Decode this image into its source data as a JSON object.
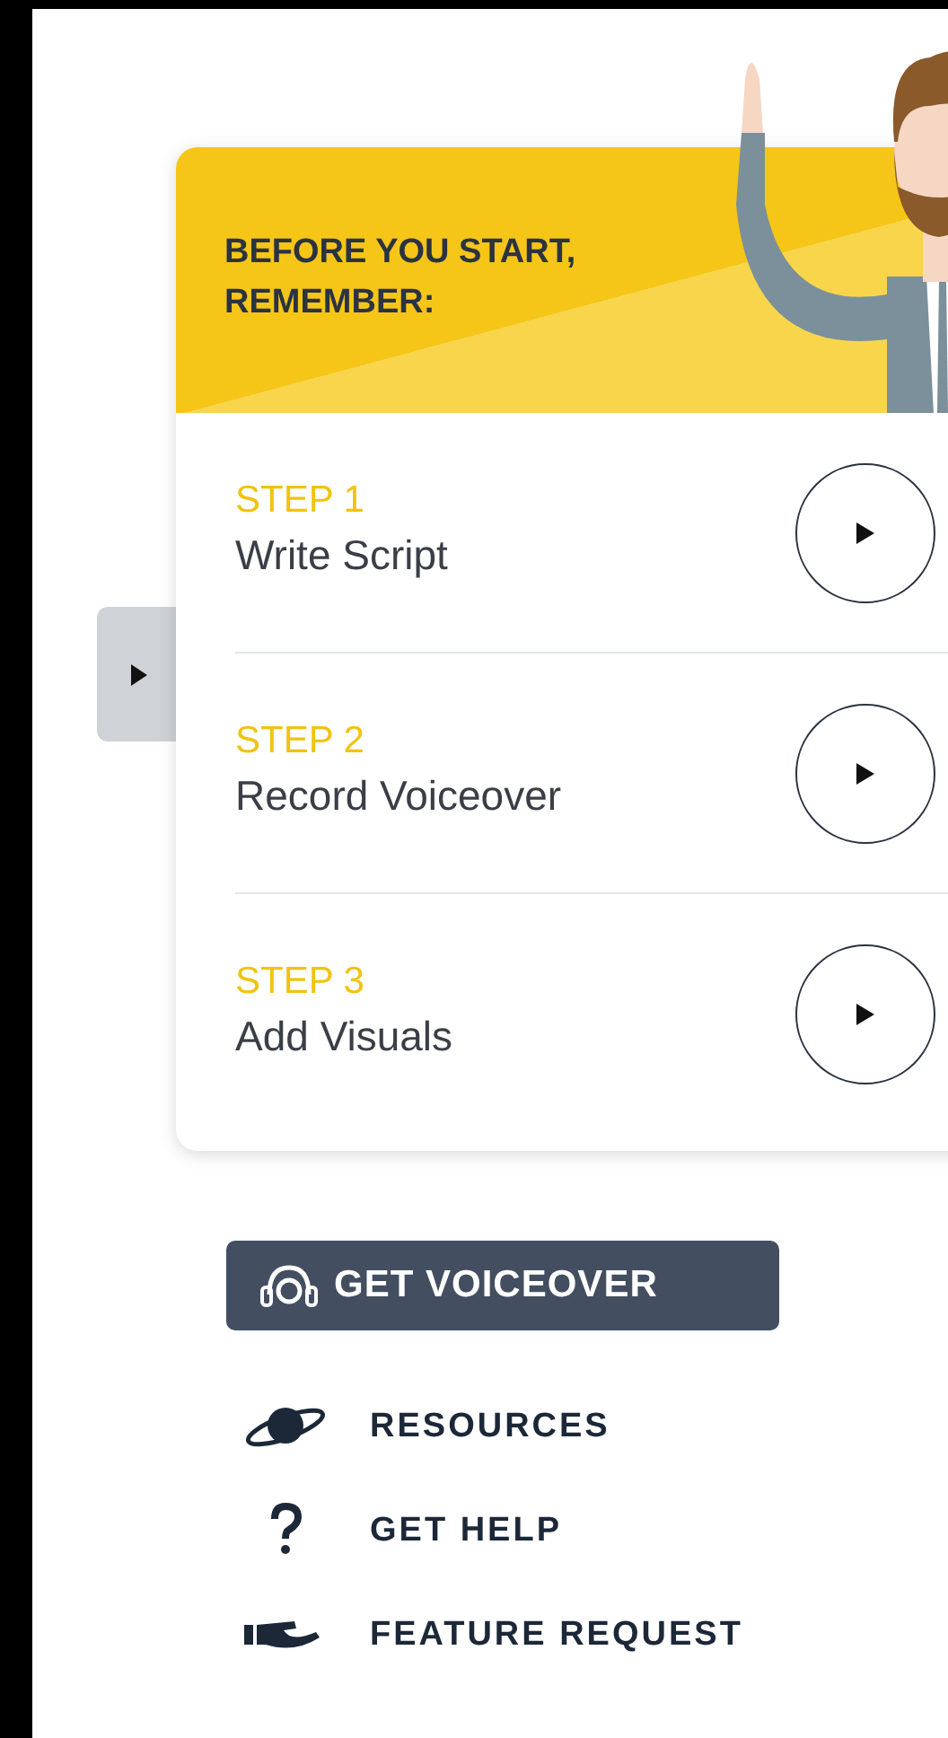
{
  "header": {
    "title": "BEFORE YOU START, REMEMBER:"
  },
  "steps": [
    {
      "label": "STEP 1",
      "title": "Write Script"
    },
    {
      "label": "STEP 2",
      "title": "Record Voiceover"
    },
    {
      "label": "STEP 3",
      "title": "Add Visuals"
    }
  ],
  "get_voiceover_button": "GET VOICEOVER",
  "links": [
    {
      "kind": "planet",
      "label": "RESOURCES"
    },
    {
      "kind": "help",
      "label": "GET HELP"
    },
    {
      "kind": "hand",
      "label": "FEATURE REQUEST"
    }
  ]
}
